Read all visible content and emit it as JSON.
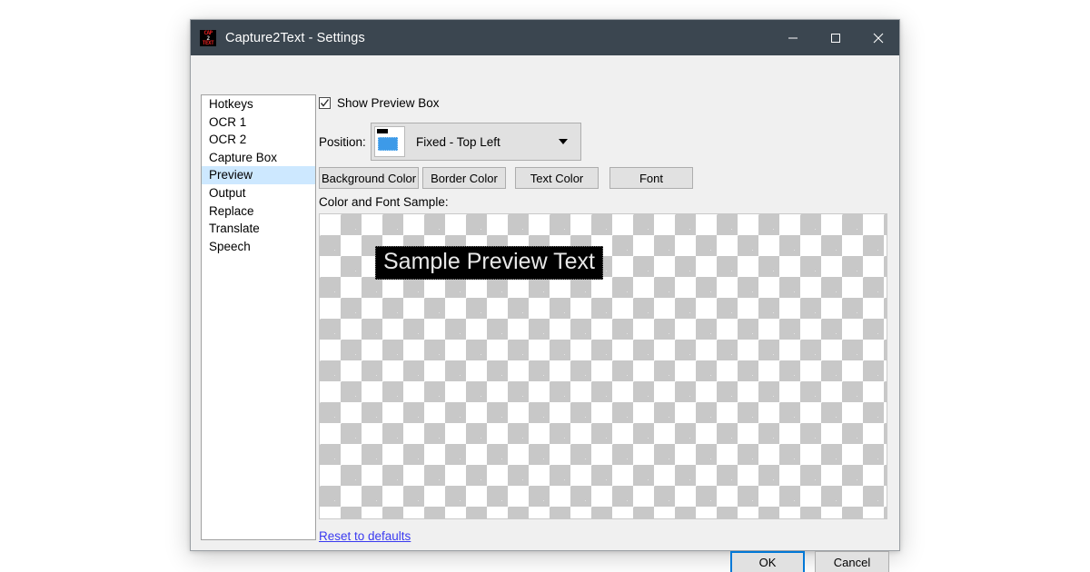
{
  "window": {
    "title": "Capture2Text - Settings",
    "icon": "app-icon-capture2text",
    "icon_rows": [
      "CAP",
      "2",
      "TEXT"
    ],
    "titlebar_color": "#3b4650",
    "controls": {
      "minimize": "minimize-icon",
      "maximize": "maximize-icon",
      "close": "close-icon"
    }
  },
  "sidebar": {
    "items": [
      {
        "label": "Hotkeys",
        "selected": false
      },
      {
        "label": "OCR 1",
        "selected": false
      },
      {
        "label": "OCR 2",
        "selected": false
      },
      {
        "label": "Capture Box",
        "selected": false
      },
      {
        "label": "Preview",
        "selected": true
      },
      {
        "label": "Output",
        "selected": false
      },
      {
        "label": "Replace",
        "selected": false
      },
      {
        "label": "Translate",
        "selected": false
      },
      {
        "label": "Speech",
        "selected": false
      }
    ],
    "selection_color": "#cde8ff"
  },
  "pane": {
    "show_preview_box": {
      "label": "Show Preview Box",
      "checked": true
    },
    "position": {
      "label": "Position:",
      "value": "Fixed - Top Left",
      "thumb": "position-top-left-thumb"
    },
    "buttons": {
      "background_color": "Background Color",
      "border_color": "Border Color",
      "text_color": "Text Color",
      "font": "Font"
    },
    "sample": {
      "label": "Color and Font Sample:",
      "preview_text": "Sample Preview Text",
      "preview_bg": "#000000",
      "preview_fg": "#e8e8e8",
      "checker_light": "#ffffff",
      "checker_dark": "#c8c8c8"
    }
  },
  "footer": {
    "reset_link": "Reset to defaults",
    "reset_link_color": "#3a3af0",
    "ok": "OK",
    "cancel": "Cancel",
    "focus_color": "#0078d7"
  }
}
